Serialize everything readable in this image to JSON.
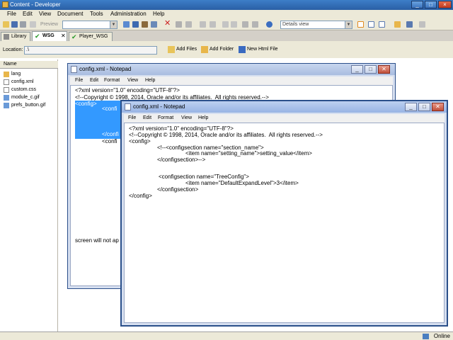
{
  "app": {
    "title": "Content - Developer"
  },
  "menu": [
    "File",
    "Edit",
    "View",
    "Document",
    "Tools",
    "Administration",
    "Help"
  ],
  "toolbar": {
    "preview_label": "Preview",
    "view_select": "Details view"
  },
  "tabs": [
    {
      "label": "Library",
      "active": false
    },
    {
      "label": "WSG",
      "active": true
    },
    {
      "label": "Player_WSG",
      "active": false
    }
  ],
  "location": {
    "label": "Location:",
    "value": ".\\"
  },
  "actions": [
    "Add Files",
    "Add Folder",
    "New Html File"
  ],
  "filelist": {
    "header": "Name",
    "items": [
      "lang",
      "config.xml",
      "custom.css",
      "module_c.gif",
      "prefs_button.gif"
    ]
  },
  "notepad_back": {
    "title": "config.xml - Notepad",
    "menu": [
      "File",
      "Edit",
      "Format",
      "View",
      "Help"
    ],
    "lines": [
      "<?xml version=\"1.0\" encoding=\"UTF-8\"?>",
      "<!--Copyright © 1998, 2014, Oracle and/or its affiliates.  All rights reserved.-->",
      "<config>",
      "<confi",
      "</confi",
      "<confi",
      "screen will not ap"
    ]
  },
  "notepad_front": {
    "title": "config.xml - Notepad",
    "menu": [
      "File",
      "Edit",
      "Format",
      "View",
      "Help"
    ],
    "lines": [
      "<?xml version=\"1.0\" encoding=\"UTF-8\"?>",
      "<!--Copyright © 1998, 2014, Oracle and/or its affiliates.  All rights reserved.-->",
      "<config>",
      "<!--<configsection name=\"section_name\">",
      "<item name=\"setting_name\">setting_value</item>",
      "</configsection>-->",
      "<configsection name=\"TreeConfig\">",
      "<item name=\"DefaultExpandLevel\">3</item>",
      "</configsection>",
      "</config>"
    ]
  },
  "status": {
    "text": "Online"
  },
  "colors": {
    "titlebar": "#2a5fa5",
    "selection": "#3399ff",
    "window_frame": "#2a4f8a"
  }
}
